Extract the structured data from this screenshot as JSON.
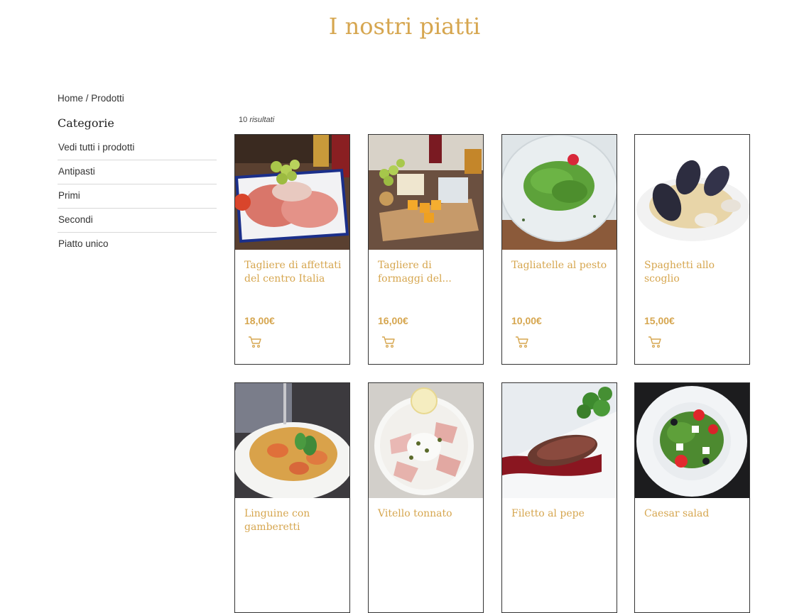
{
  "page": {
    "title": "I nostri piatti"
  },
  "breadcrumb": {
    "home": "Home",
    "separator": " / ",
    "current": "Prodotti"
  },
  "sidebar": {
    "heading": "Categorie",
    "items": [
      {
        "label": "Vedi tutti i prodotti"
      },
      {
        "label": "Antipasti"
      },
      {
        "label": "Primi"
      },
      {
        "label": "Secondi"
      },
      {
        "label": "Piatto unico"
      }
    ]
  },
  "results": {
    "count": "10",
    "label": "risultati"
  },
  "products": [
    {
      "name": "Tagliere di affettati del centro Italia",
      "price": "18,00€",
      "icon": "cart-icon"
    },
    {
      "name": "Tagliere di formaggi del...",
      "price": "16,00€",
      "icon": "cart-icon"
    },
    {
      "name": "Tagliatelle al pesto",
      "price": "10,00€",
      "icon": "cart-icon"
    },
    {
      "name": "Spaghetti allo scoglio",
      "price": "15,00€",
      "icon": "cart-icon"
    },
    {
      "name": "Linguine con gamberetti",
      "price": "",
      "icon": ""
    },
    {
      "name": "Vitello tonnato",
      "price": "",
      "icon": ""
    },
    {
      "name": "Filetto al pepe",
      "price": "",
      "icon": ""
    },
    {
      "name": "Caesar salad",
      "price": "",
      "icon": ""
    }
  ],
  "colors": {
    "accent": "#d6a64f",
    "border": "#333333",
    "divider": "#d8d8d8"
  }
}
